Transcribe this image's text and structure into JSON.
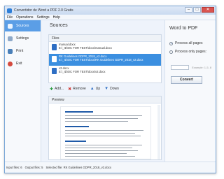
{
  "window": {
    "title": "Convertidor de Word a PDF 2.0 Gratis"
  },
  "menu": [
    "File",
    "Operations",
    "Settings",
    "Help"
  ],
  "sidebar": {
    "items": [
      {
        "label": "Sources"
      },
      {
        "label": "Settings"
      },
      {
        "label": "Print"
      },
      {
        "label": "Exit"
      }
    ]
  },
  "main": {
    "title": "Sources",
    "files_label": "Files",
    "files": [
      {
        "name": "manual.docx",
        "path": "E:\\_ID\\OC FOR TEST\\docx\\manual.docx"
      },
      {
        "name": "RK Guidelines GDPR_2018_v2.docx",
        "path": "E:\\_ID\\OC FOR TEST\\docx\\RK Guidelines GDPR_2018_v2.docx"
      },
      {
        "name": "v2.docx",
        "path": "E:\\_ID\\OC FOR TEST\\docx\\v2.docx"
      }
    ],
    "toolbar": {
      "add": "Add...",
      "remove": "Remove",
      "up": "Up",
      "down": "Down"
    },
    "preview_label": "Preview"
  },
  "right": {
    "title": "Word to PDF",
    "opt_all": "Process all pages",
    "opt_only": "Process only pages:",
    "example": "Example: 1-5, 8",
    "convert": "Convert"
  },
  "status": {
    "input": "Input files: 6",
    "output": "Output files: 5",
    "selected": "Selected file: RK Guidelines GDPR_2018_v2.docx"
  }
}
